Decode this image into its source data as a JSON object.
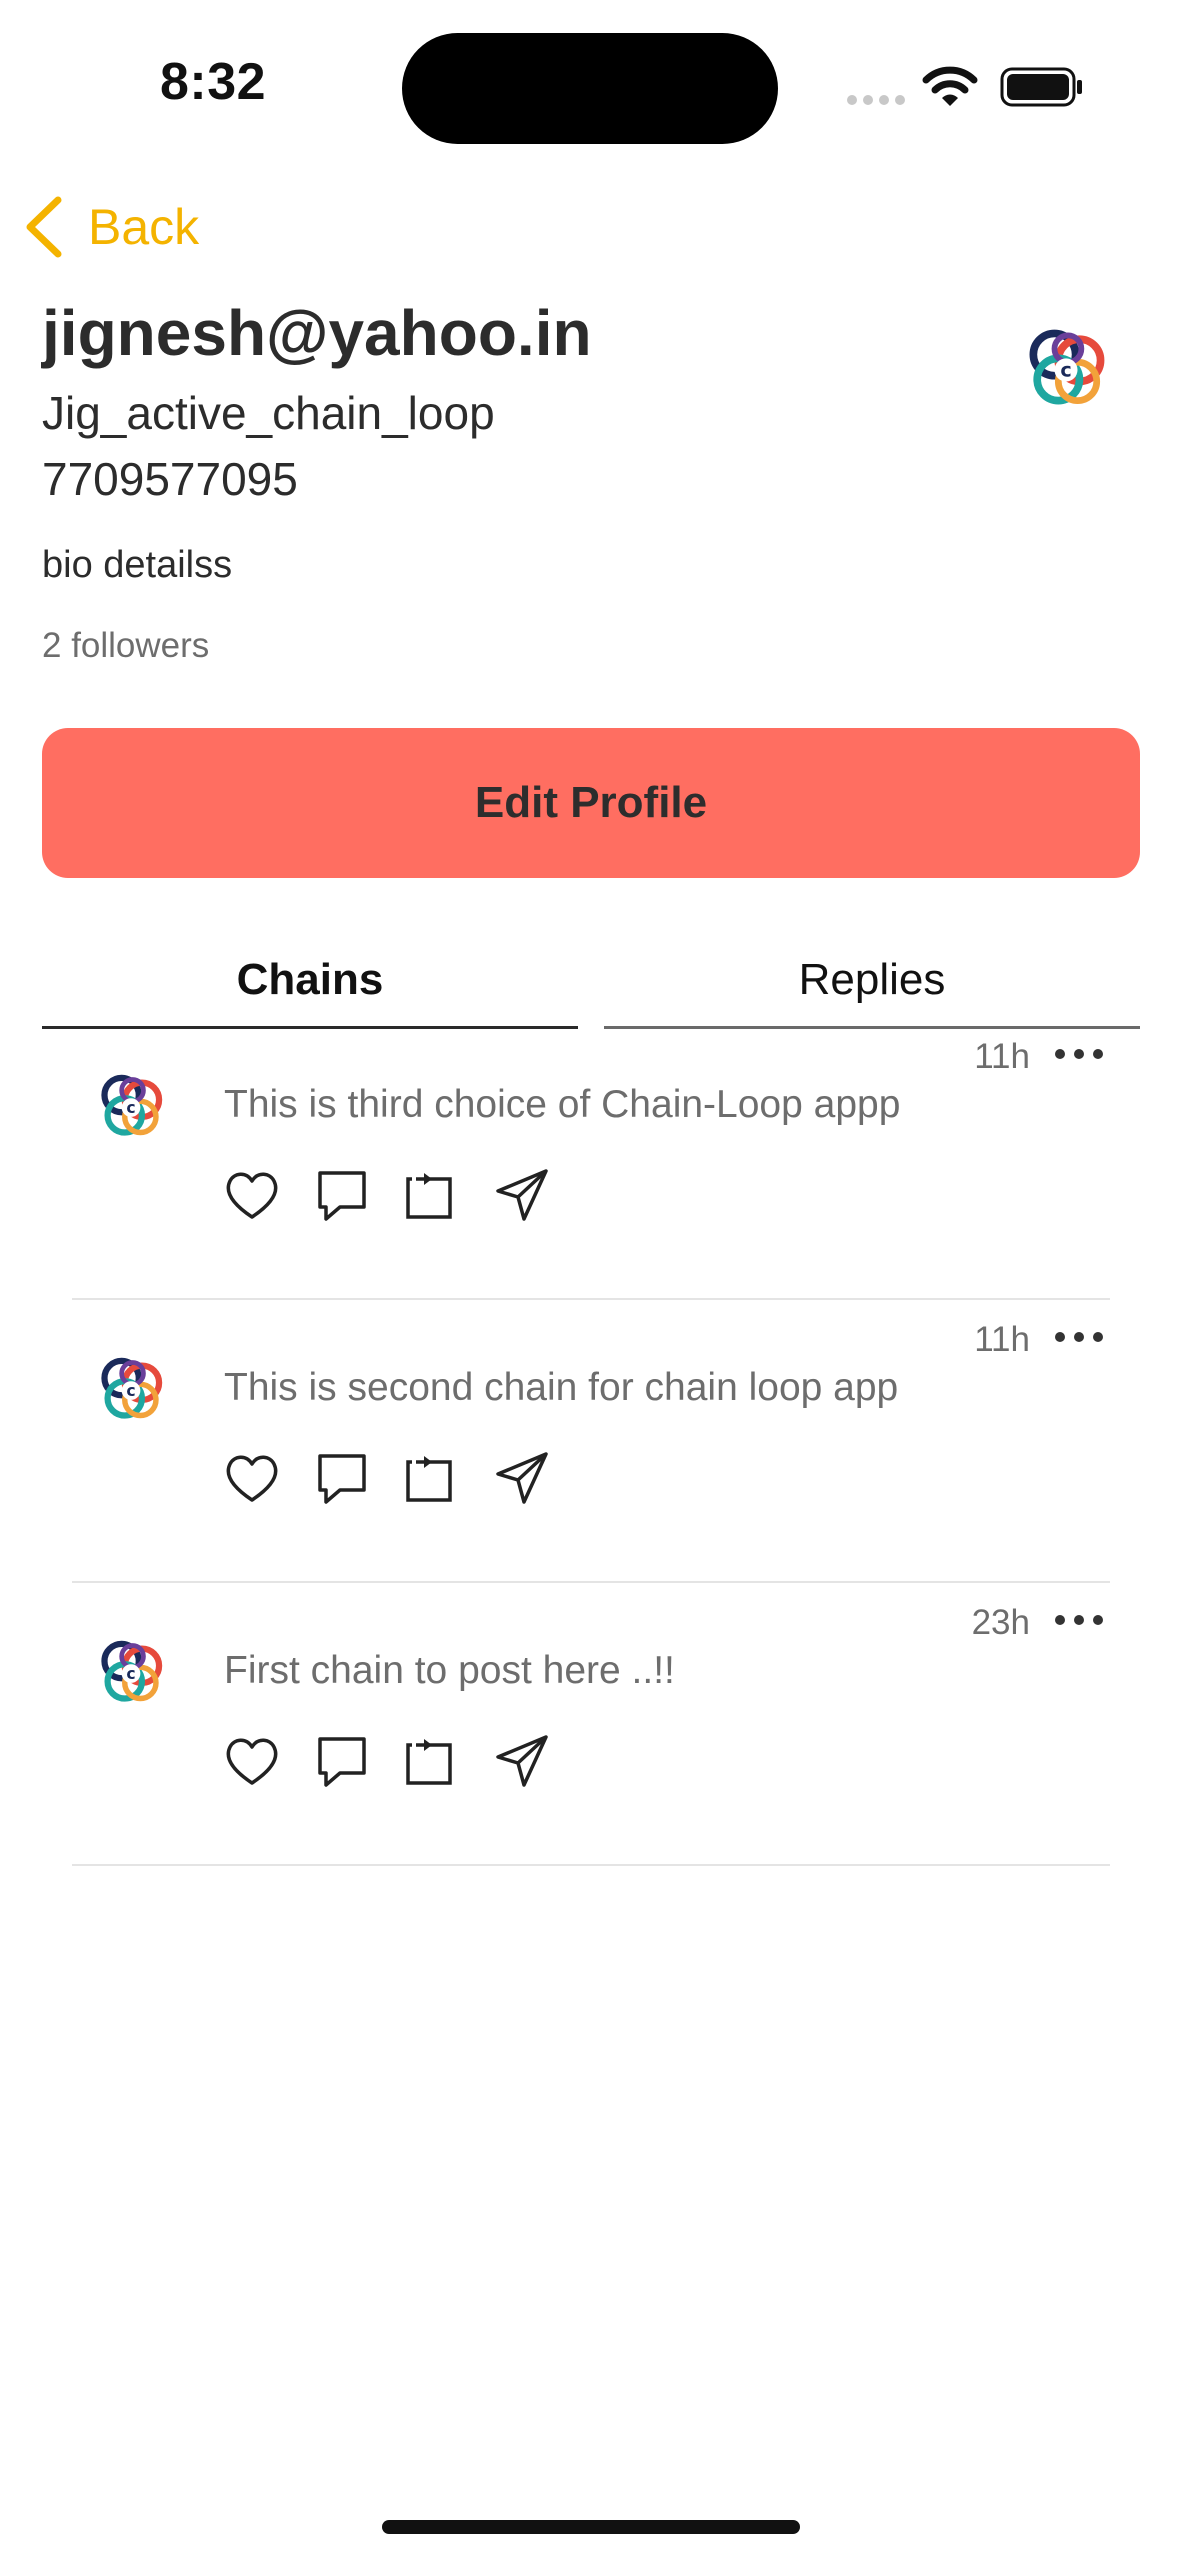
{
  "status_bar": {
    "time": "8:32"
  },
  "nav": {
    "back_label": "Back"
  },
  "profile": {
    "email": "jignesh@yahoo.in",
    "username": "Jig_active_chain_loop",
    "phone": "7709577095",
    "bio": "bio detailss",
    "followers": "2 followers"
  },
  "edit_button_label": "Edit Profile",
  "tabs": [
    {
      "label": "Chains",
      "active": true
    },
    {
      "label": "Replies",
      "active": false
    }
  ],
  "posts": [
    {
      "time": "11h",
      "text": "This is third choice of Chain-Loop appp"
    },
    {
      "time": "11h",
      "text": "This is second chain for chain loop app"
    },
    {
      "time": "23h",
      "text": "First chain to post here ..!!"
    }
  ],
  "colors": {
    "accent": "#F4B300",
    "button": "#FF6E61"
  },
  "icons": [
    "chevron-left-icon",
    "logo-icon",
    "more-icon",
    "heart-icon",
    "comment-icon",
    "repost-icon",
    "send-icon"
  ]
}
